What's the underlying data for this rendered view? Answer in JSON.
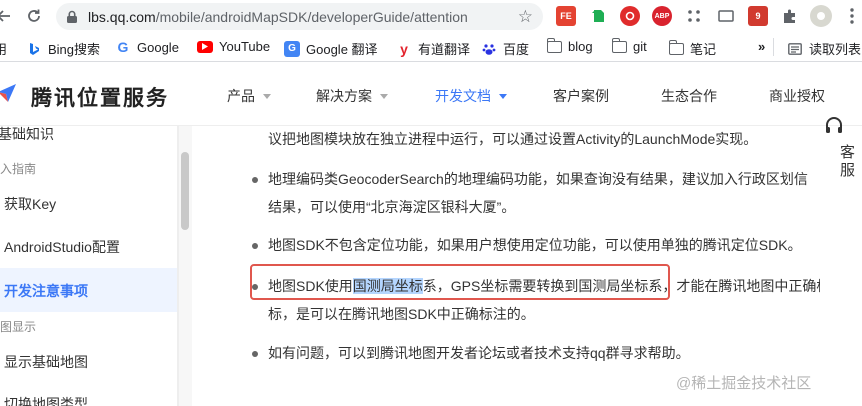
{
  "browser": {
    "url_host": "lbs.qq.com",
    "url_path": "/mobile/androidMapSDK/developerGuide/attention",
    "extensions": [
      "FE",
      "evernote-icon",
      "ABP",
      "9"
    ]
  },
  "bookmarks": {
    "overflow_label": "»",
    "reading_list": "读取列表",
    "items": [
      {
        "label": "用",
        "icon": "apps-icon"
      },
      {
        "label": "Bing搜索",
        "icon": "bing-icon"
      },
      {
        "label": "Google",
        "icon": "google-icon"
      },
      {
        "label": "YouTube",
        "icon": "youtube-icon"
      },
      {
        "label": "Google 翻译",
        "icon": "translate-icon"
      },
      {
        "label": "有道翻译",
        "icon": "youdao-icon"
      },
      {
        "label": "百度",
        "icon": "baidu-icon"
      },
      {
        "label": "blog",
        "icon": "folder-icon"
      },
      {
        "label": "git",
        "icon": "folder-icon"
      },
      {
        "label": "笔记",
        "icon": "folder-icon"
      }
    ]
  },
  "site": {
    "logo": "腾讯位置服务",
    "nav": [
      {
        "label": "产品",
        "dropdown": true
      },
      {
        "label": "解决方案",
        "dropdown": true
      },
      {
        "label": "开发文档",
        "dropdown": true,
        "active": true
      },
      {
        "label": "客户案例",
        "dropdown": false
      },
      {
        "label": "生态合作",
        "dropdown": false
      },
      {
        "label": "商业授权",
        "dropdown": false
      }
    ],
    "accent": "#3c78f6"
  },
  "sidebar": {
    "items": [
      {
        "label": "基础知识",
        "kind": "item"
      },
      {
        "label": "入指南",
        "kind": "group"
      },
      {
        "label": "获取Key",
        "kind": "item"
      },
      {
        "label": "AndroidStudio配置",
        "kind": "item"
      },
      {
        "label": "开发注意事项",
        "kind": "active"
      },
      {
        "label": "图显示",
        "kind": "group"
      },
      {
        "label": "显示基础地图",
        "kind": "item"
      },
      {
        "label": "切换地图类型",
        "kind": "item"
      }
    ]
  },
  "content": {
    "line0": "议把地图模块放在独立进程中运行，可以通过设置Activity的LaunchMode实现。",
    "b1_l1": "地理编码类GeocoderSearch的地理编码功能，如果查询没有结果，建议加入行政区划信",
    "b1_l2": "结果，可以使用“北京海淀区银科大厦”。",
    "b2_l1": "地图SDK不包含定位功能，如果用户想使用定位功能，可以使用单独的腾讯定位SDK。",
    "b3_pre": "地图SDK使用",
    "b3_hl": "国测局坐标",
    "b3_mid": "系，GPS坐标需要转换到国测局坐标系",
    "b3_post": "，才能在腾讯地图中正确标注,",
    "b3_l2": "标，是可以在腾讯地图SDK中正确标注的。",
    "b4_l1": "如有问题，可以到腾讯地图开发者论坛或者技术支持qq群寻求帮助。"
  },
  "float": {
    "kefu": "客服"
  },
  "watermark": "@稀土掘金技术社区"
}
